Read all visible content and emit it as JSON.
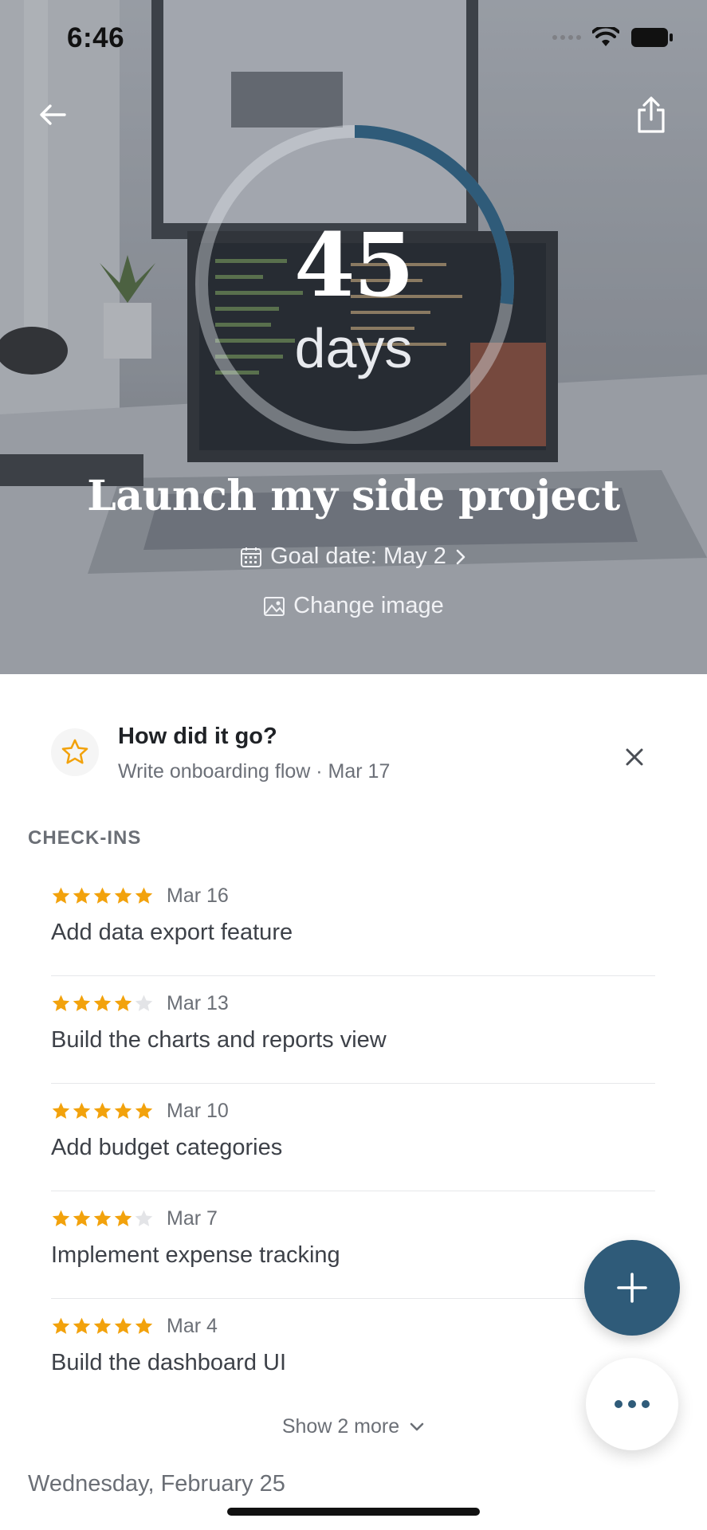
{
  "status_bar": {
    "time": "6:46"
  },
  "hero": {
    "count": "45",
    "unit": "days",
    "progress": 0.27,
    "title": "Launch my side project",
    "goal_date": "Goal date: May 2",
    "change_image": "Change image"
  },
  "prompt": {
    "title": "How did it go?",
    "subtitle": "Write onboarding flow · Mar 17"
  },
  "checkins": {
    "section_title": "CHECK-INS",
    "items": [
      {
        "rating": 5,
        "date": "Mar 16",
        "text": "Add data export feature"
      },
      {
        "rating": 4,
        "date": "Mar 13",
        "text": "Build the charts and reports view"
      },
      {
        "rating": 5,
        "date": "Mar 10",
        "text": "Add budget categories"
      },
      {
        "rating": 4,
        "date": "Mar 7",
        "text": "Implement expense tracking"
      },
      {
        "rating": 5,
        "date": "Mar 4",
        "text": "Build the dashboard UI"
      }
    ],
    "show_more": "Show 2 more"
  },
  "day_header": "Wednesday, February 25",
  "colors": {
    "accent": "#2f5b79",
    "star": "#f2a20c",
    "star_empty": "#e3e4e7"
  }
}
